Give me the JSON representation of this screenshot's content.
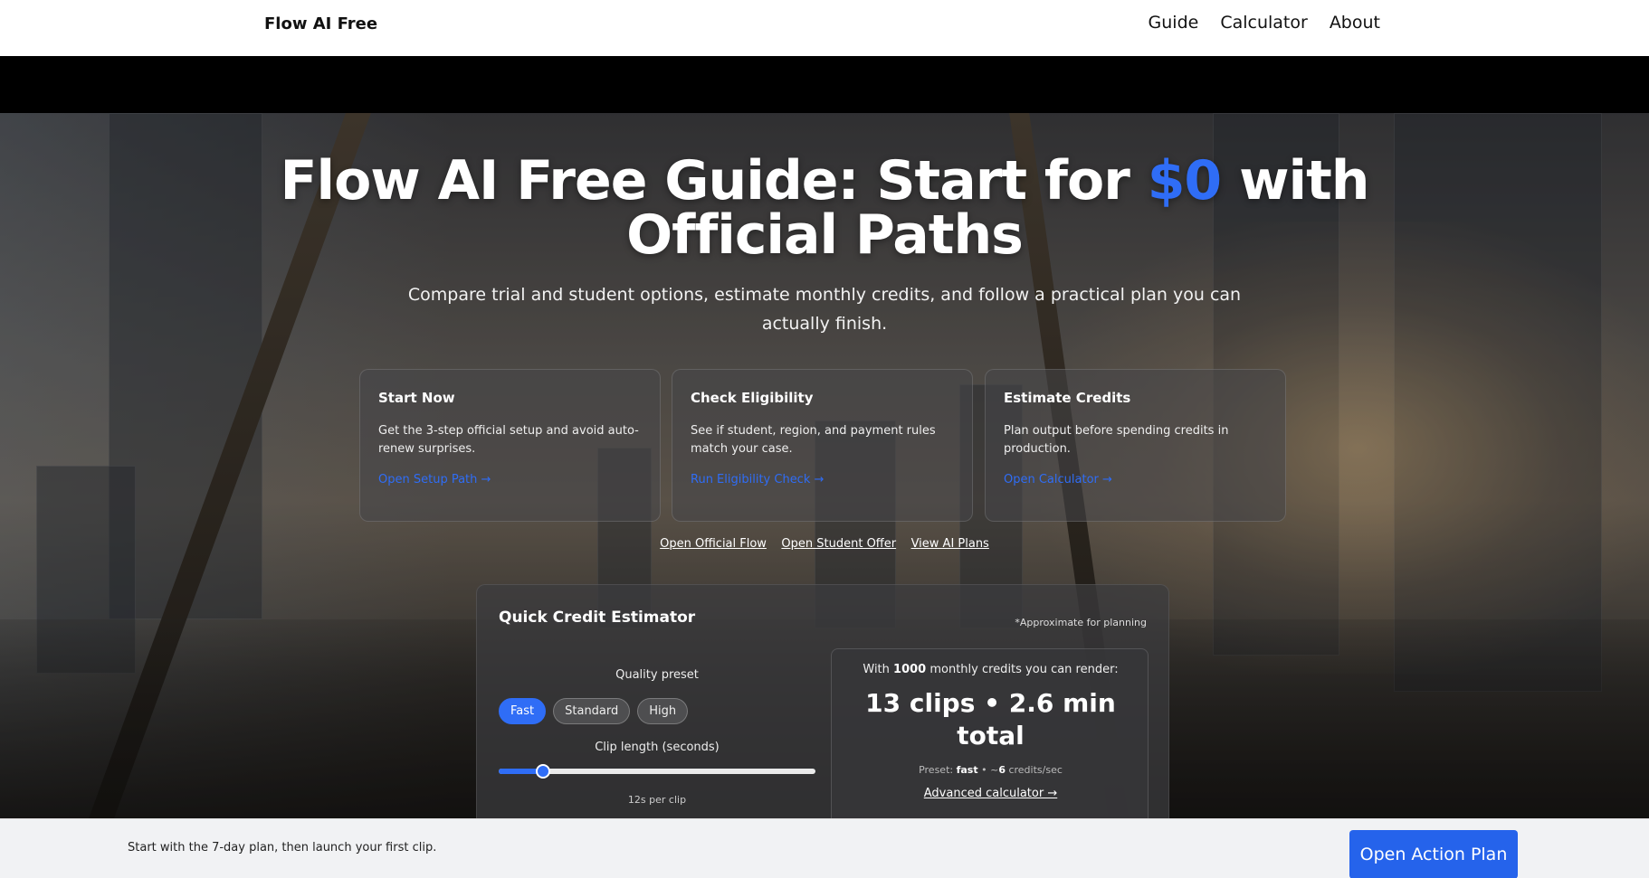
{
  "header": {
    "brand": "Flow AI Free",
    "nav": [
      "Guide",
      "Calculator",
      "About"
    ]
  },
  "hero": {
    "title_part1": "Flow AI Free Guide: Start for ",
    "title_accent": "$0",
    "title_part2": " with Official Paths",
    "subtitle": "Compare trial and student options, estimate monthly credits, and follow a practical plan you can actually finish.",
    "accent_color": "#2f6df6"
  },
  "cards": [
    {
      "title": "Start Now",
      "body": "Get the 3-step official setup and avoid auto-renew surprises.",
      "link": "Open Setup Path →"
    },
    {
      "title": "Check Eligibility",
      "body": "See if student, region, and payment rules match your case.",
      "link": "Run Eligibility Check →"
    },
    {
      "title": "Estimate Credits",
      "body": "Plan output before spending credits in production.",
      "link": "Open Calculator →"
    }
  ],
  "quick_links": [
    "Open Official Flow",
    "Open Student Offer",
    "View AI Plans"
  ],
  "estimator": {
    "title": "Quick Credit Estimator",
    "note": "*Approximate for planning",
    "quality_label": "Quality preset",
    "presets": [
      "Fast",
      "Standard",
      "High"
    ],
    "active_preset": "Fast",
    "clip_label": "Clip length (seconds)",
    "clip_fraction": 0.14,
    "per_clip": "12s per clip",
    "result_prefix": "With ",
    "credits": "1000",
    "result_suffix": " monthly credits you can render:",
    "result_big": "13 clips • 2.6 min total",
    "preset_prefix": "Preset: ",
    "preset_name": "fast",
    "preset_mid": " • ~",
    "preset_rate": "6",
    "preset_suffix": " credits/sec",
    "advanced_link": "Advanced calculator →"
  },
  "bottombar": {
    "message": "Start with the 7-day plan, then launch your first clip.",
    "cta": "Open Action Plan"
  }
}
